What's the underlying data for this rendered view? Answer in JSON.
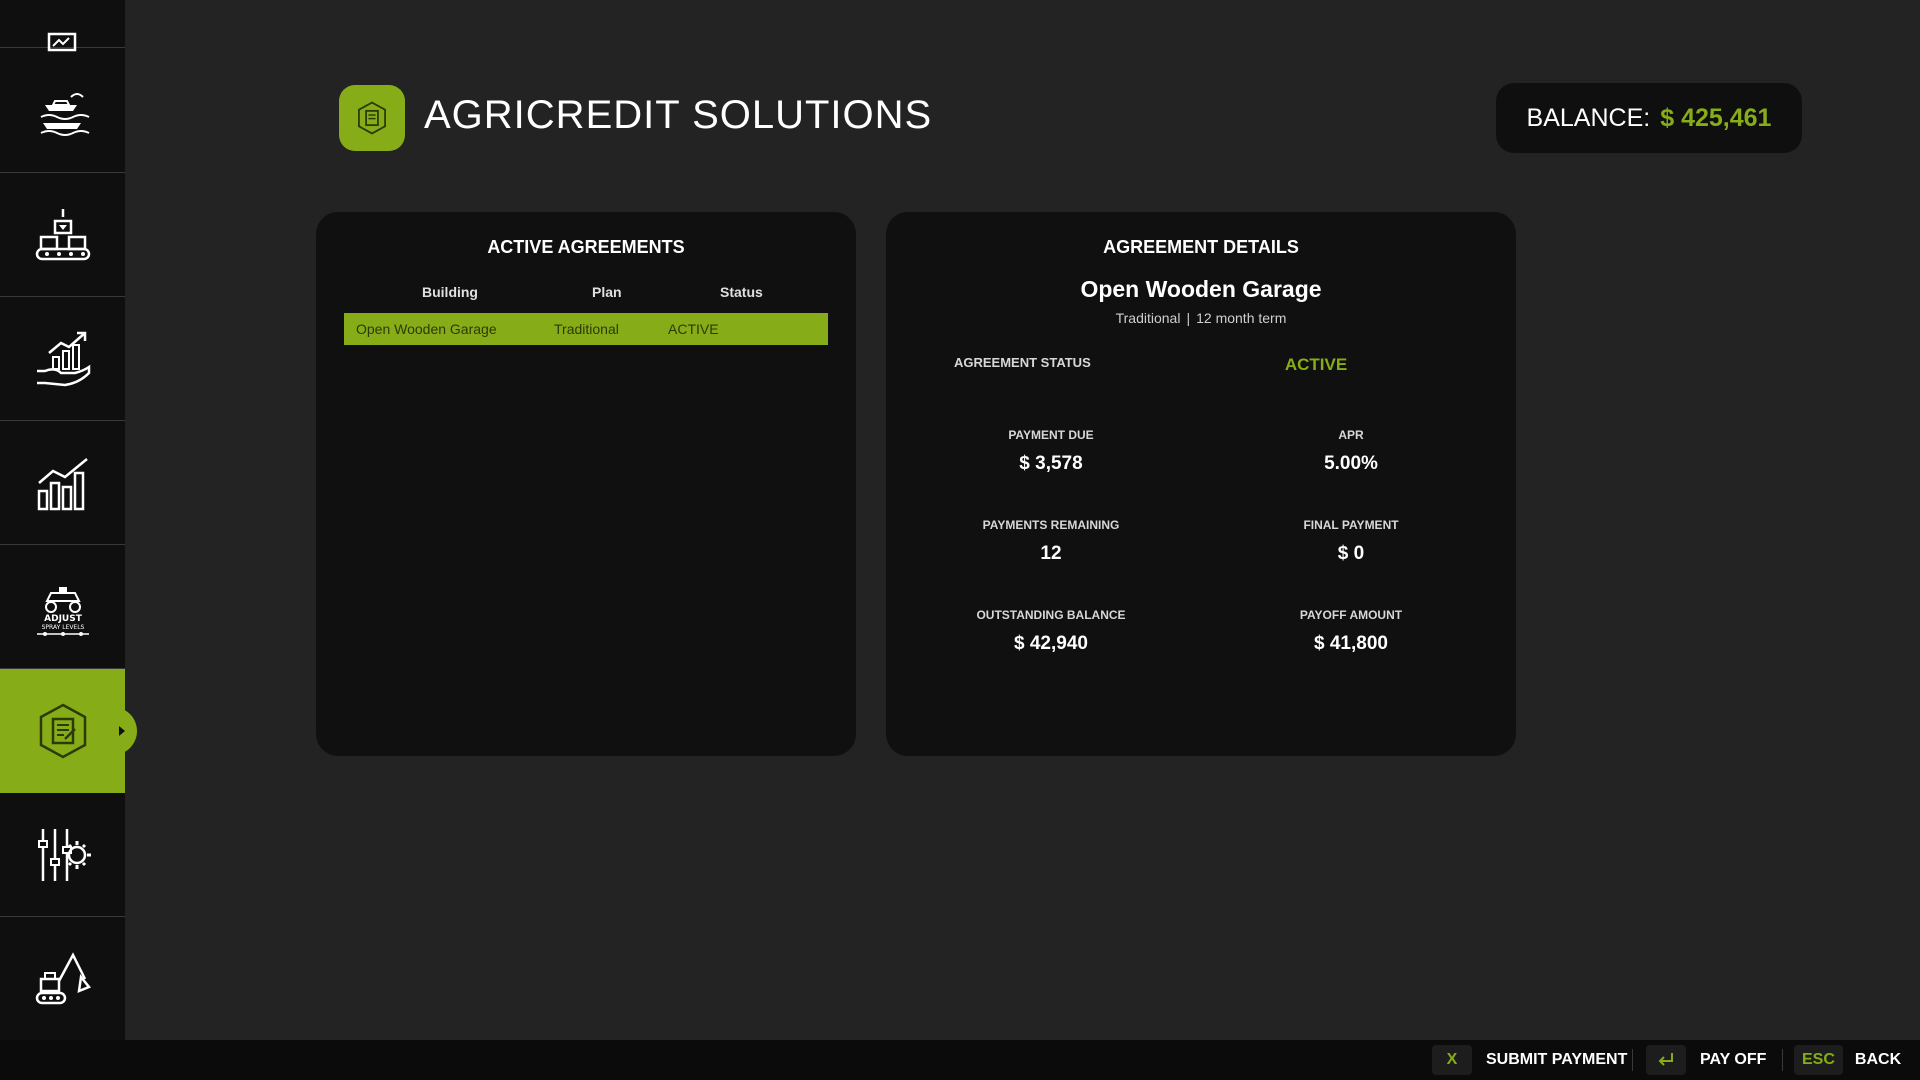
{
  "header": {
    "title": "AGRICREDIT SOLUTIONS",
    "balance_label": "BALANCE:",
    "balance_value": "$ 425,461"
  },
  "sidebar": {
    "items": [
      {
        "icon": "map-icon"
      },
      {
        "icon": "boat-icon"
      },
      {
        "icon": "production-icon"
      },
      {
        "icon": "finance-hand-icon"
      },
      {
        "icon": "bar-chart-icon"
      },
      {
        "icon": "sprayer-icon",
        "caption_line1": "ADJUST",
        "caption_line2": "SPRAY LEVELS"
      },
      {
        "icon": "agreement-icon",
        "active": true
      },
      {
        "icon": "settings-sliders-icon"
      },
      {
        "icon": "excavator-icon"
      }
    ]
  },
  "agreements": {
    "title": "ACTIVE AGREEMENTS",
    "columns": [
      "Building",
      "Plan",
      "Status"
    ],
    "rows": [
      {
        "building": "Open Wooden Garage",
        "plan": "Traditional",
        "status": "ACTIVE"
      }
    ]
  },
  "details": {
    "title": "AGREEMENT DETAILS",
    "name": "Open Wooden Garage",
    "plan": "Traditional",
    "separator": "|",
    "term": "12 month term",
    "status_label": "AGREEMENT STATUS",
    "status_value": "ACTIVE",
    "payment_due_label": "PAYMENT DUE",
    "payment_due_value": "$ 3,578",
    "apr_label": "APR",
    "apr_value": "5.00%",
    "payments_remaining_label": "PAYMENTS REMAINING",
    "payments_remaining_value": "12",
    "final_payment_label": "FINAL PAYMENT",
    "final_payment_value": "$ 0",
    "outstanding_label": "OUTSTANDING BALANCE",
    "outstanding_value": "$ 42,940",
    "payoff_label": "PAYOFF AMOUNT",
    "payoff_value": "$ 41,800"
  },
  "footer": {
    "submit_key": "X",
    "submit_label": "SUBMIT PAYMENT",
    "payoff_key_icon": "enter-icon",
    "payoff_label": "PAY OFF",
    "back_key": "ESC",
    "back_label": "BACK"
  },
  "colors": {
    "accent": "#86ad17",
    "background": "#232323",
    "panel": "#101010",
    "sidebar": "#0f0f0f"
  }
}
